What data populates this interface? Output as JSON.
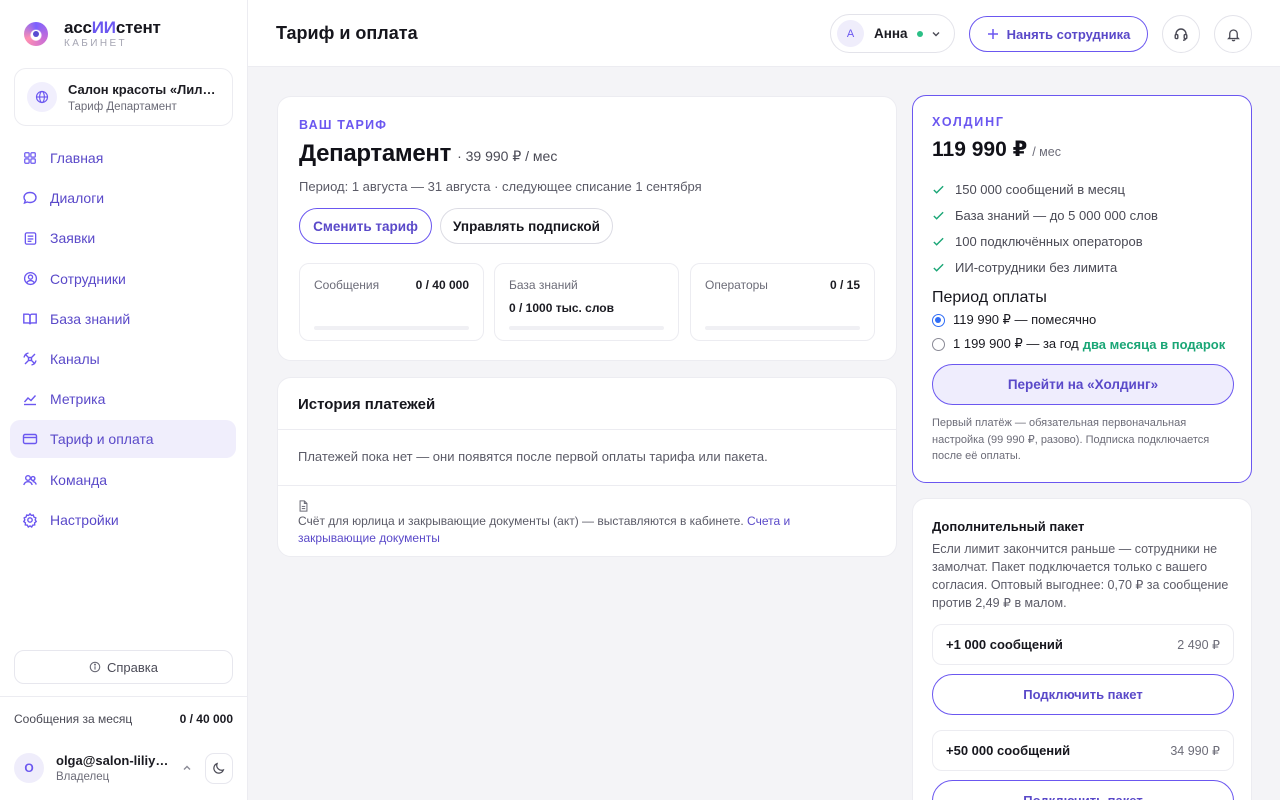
{
  "brand": {
    "name_prefix": "асс",
    "name_accent": "ИИ",
    "name_suffix": "стент",
    "subtitle": "КАБИНЕТ"
  },
  "org": {
    "name": "Салон красоты «Лилия»",
    "plan": "Тариф Департамент",
    "icon": "globe-icon"
  },
  "nav": [
    {
      "label": "Главная",
      "icon": "grid-icon",
      "active": false
    },
    {
      "label": "Диалоги",
      "icon": "chat-icon",
      "active": false
    },
    {
      "label": "Заявки",
      "icon": "inbox-icon",
      "active": false
    },
    {
      "label": "Сотрудники",
      "icon": "user-circle-icon",
      "active": false
    },
    {
      "label": "База знаний",
      "icon": "book-icon",
      "active": false
    },
    {
      "label": "Каналы",
      "icon": "satellite-icon",
      "active": false
    },
    {
      "label": "Метрика",
      "icon": "chart-line-icon",
      "active": false
    },
    {
      "label": "Тариф и оплата",
      "icon": "card-icon",
      "active": true
    },
    {
      "label": "Команда",
      "icon": "team-icon",
      "active": false
    },
    {
      "label": "Настройки",
      "icon": "gear-icon",
      "active": false
    }
  ],
  "help": {
    "label": "Справка"
  },
  "sidebar_usage": {
    "label": "Сообщения за месяц",
    "value": "0 / 40 000"
  },
  "account": {
    "initial": "O",
    "email": "olga@salon-liliya.ru",
    "role": "Владелец"
  },
  "header": {
    "title": "Тариф и оплата",
    "user_initial": "А",
    "user_name": "Анна",
    "hire_label": "Нанять сотрудника"
  },
  "tariff": {
    "eyebrow": "ВАШ ТАРИФ",
    "name": "Департамент",
    "price": "· 39 990 ₽ / мес",
    "period": "Период: 1 августа — 31 августа · следующее списание 1 сентября",
    "change_label": "Сменить тариф",
    "manage_label": "Управлять подпиской",
    "metrics": [
      {
        "label": "Сообщения",
        "value": "0 / 40 000",
        "fill": 0
      },
      {
        "label": "База знаний",
        "value": "0 / 1000 тыс. слов",
        "fill": 0
      },
      {
        "label": "Операторы",
        "value": "0 / 15",
        "fill": 0
      }
    ]
  },
  "history": {
    "title": "История платежей",
    "empty": "Платежей пока нет — они появятся после первой оплаты тарифа или пакета.",
    "doc_note": "Счёт для юрлица и закрывающие документы (акт) — выставляются в кабинете.",
    "doc_link": "Счета и закрывающие документы"
  },
  "holding": {
    "eyebrow": "ХОЛДИНГ",
    "price": "119 990 ₽",
    "per": "/ мес",
    "features": [
      "150 000 сообщений в месяц",
      "База знаний — до 5 000 000 слов",
      "100 подключённых операторов",
      "ИИ-сотрудники без лимита"
    ],
    "period_title": "Период оплаты",
    "option_monthly": "119 990 ₽ — помесячно",
    "option_yearly": "1 199 900 ₽ — за год",
    "option_yearly_gift": "два месяца в подарок",
    "selected": "monthly",
    "goto_label": "Перейти на «Холдинг»",
    "note": "Первый платёж — обязательная первоначальная настройка (99 990 ₽, разово). Подписка подключается после её оплаты."
  },
  "addon": {
    "title": "Дополнительный пакет",
    "desc": "Если лимит закончится раньше — сотрудники не замолчат. Пакет подключается только с вашего согласия. Оптовый выгоднее: 0,70 ₽ за сообщение против 2,49 ₽ в малом.",
    "packs": [
      {
        "name": "+1 000 сообщений",
        "price": "2 490 ₽",
        "button": "Подключить пакет"
      },
      {
        "name": "+50 000 сообщений",
        "price": "34 990 ₽",
        "button": "Подключить пакет"
      }
    ]
  },
  "colors": {
    "accent": "#6b57f0",
    "accent_text": "#5a49c9",
    "success": "#1aa676",
    "online": "#2bbf86",
    "radio": "#2f6df6"
  }
}
